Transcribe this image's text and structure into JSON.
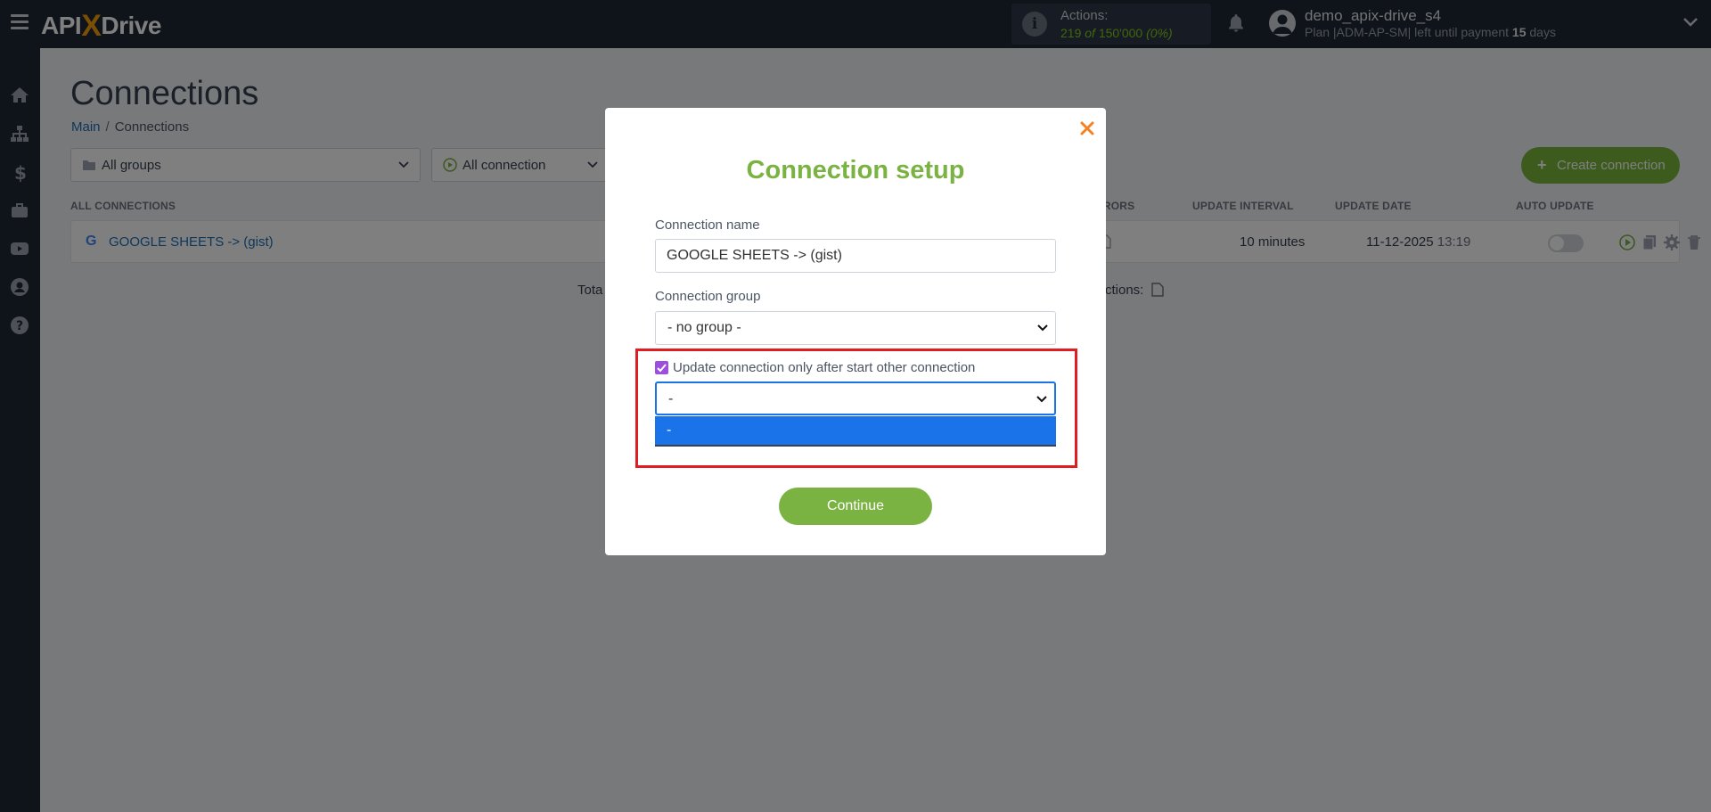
{
  "topbar": {
    "logo": {
      "api": "API",
      "x": "X",
      "drive": "Drive"
    },
    "actions": {
      "title": "Actions:",
      "used": "219",
      "of": "of",
      "limit": "150'000",
      "percent": "(0%)"
    },
    "user": {
      "name": "demo_apix-drive_s4",
      "plan_prefix": "Plan |ADM-AP-SM| left until payment",
      "days": "15",
      "days_suffix": "days"
    }
  },
  "sidebar": {
    "items": [
      "home-icon",
      "sitemap-icon",
      "dollar-icon",
      "briefcase-icon",
      "youtube-icon",
      "user-icon",
      "help-icon"
    ]
  },
  "page": {
    "title": "Connections",
    "breadcrumb": {
      "main": "Main",
      "sep": "/",
      "current": "Connections"
    },
    "filters": {
      "groups": "All groups",
      "connections": "All connection"
    },
    "create_button": "Create connection",
    "columns": {
      "all_connections": "ALL CONNECTIONS",
      "errors": "RRORS",
      "update_interval": "UPDATE INTERVAL",
      "update_date": "UPDATE DATE",
      "auto_update": "AUTO UPDATE"
    },
    "rows": [
      {
        "icon": "G",
        "name": "GOOGLE SHEETS -> (gist)",
        "interval": "10 minutes",
        "date": "11-12-2025",
        "time": "13:19",
        "auto_update": false
      }
    ],
    "total_text": "Tota",
    "total_right_text": "ctions:"
  },
  "modal": {
    "title": "Connection setup",
    "name_label": "Connection name",
    "name_value": "GOOGLE SHEETS -> (gist)",
    "group_label": "Connection group",
    "group_value": "- no group -",
    "checkbox_label": "Update connection only after start other connection",
    "checkbox_checked": true,
    "dependency_value": "-",
    "dropdown_options": [
      "-"
    ],
    "continue_label": "Continue"
  },
  "colors": {
    "accent_green": "#7ab342",
    "dropdown_blue": "#1a73e8",
    "highlight_red": "#e11d24",
    "checkbox_purple": "#9d4edd",
    "topbar": "#1f2937",
    "logo_x": "#f59e0b"
  }
}
